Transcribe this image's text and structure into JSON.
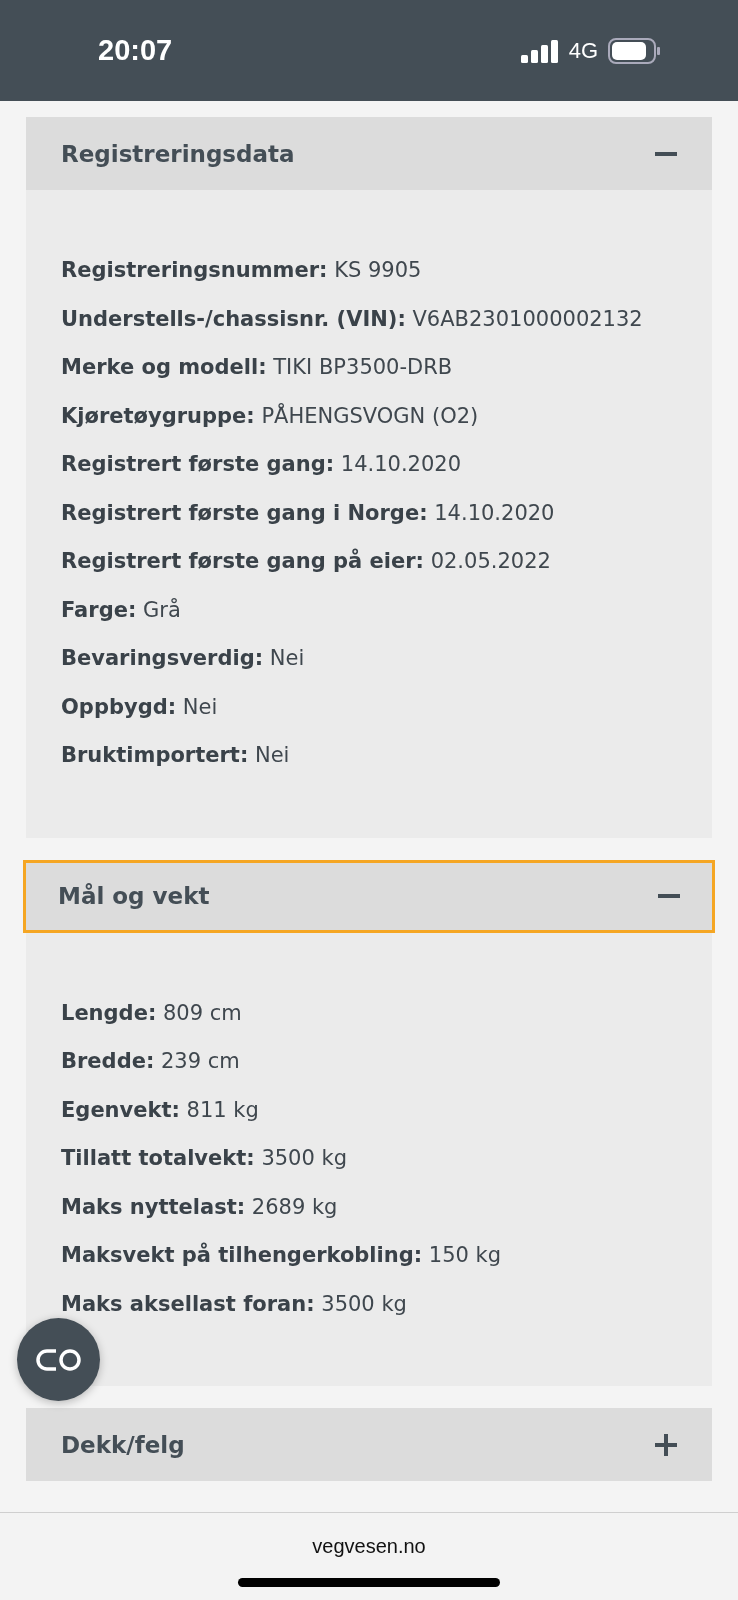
{
  "status_bar": {
    "time": "20:07",
    "network": "4G"
  },
  "sections": [
    {
      "title": "Registreringsdata",
      "expanded": true,
      "focused": false,
      "fields": [
        {
          "label": "Registreringsnummer:",
          "value": "KS 9905"
        },
        {
          "label": "Understells-/chassisnr. (VIN):",
          "value": "V6AB2301000002132"
        },
        {
          "label": "Merke og modell:",
          "value": "TIKI BP3500-DRB"
        },
        {
          "label": "Kjøretøygruppe:",
          "value": "PÅHENGSVOGN (O2)"
        },
        {
          "label": "Registrert første gang:",
          "value": "14.10.2020"
        },
        {
          "label": "Registrert første gang i Norge:",
          "value": "14.10.2020"
        },
        {
          "label": "Registrert første gang på eier:",
          "value": "02.05.2022"
        },
        {
          "label": "Farge:",
          "value": "Grå"
        },
        {
          "label": "Bevaringsverdig:",
          "value": "Nei"
        },
        {
          "label": "Oppbygd:",
          "value": "Nei"
        },
        {
          "label": "Bruktimportert:",
          "value": "Nei"
        }
      ]
    },
    {
      "title": "Mål og vekt",
      "expanded": true,
      "focused": true,
      "fields": [
        {
          "label": "Lengde:",
          "value": "809 cm"
        },
        {
          "label": "Bredde:",
          "value": "239 cm"
        },
        {
          "label": "Egenvekt:",
          "value": "811 kg"
        },
        {
          "label": "Tillatt totalvekt:",
          "value": "3500 kg"
        },
        {
          "label": "Maks nyttelast:",
          "value": "2689 kg"
        },
        {
          "label": "Maksvekt på tilhengerkobling:",
          "value": "150 kg"
        },
        {
          "label": "Maks aksellast foran:",
          "value": "3500 kg"
        }
      ]
    },
    {
      "title": "Dekk/felg",
      "expanded": false,
      "focused": false
    }
  ],
  "browser_bar": {
    "url": "vegvesen.no"
  }
}
